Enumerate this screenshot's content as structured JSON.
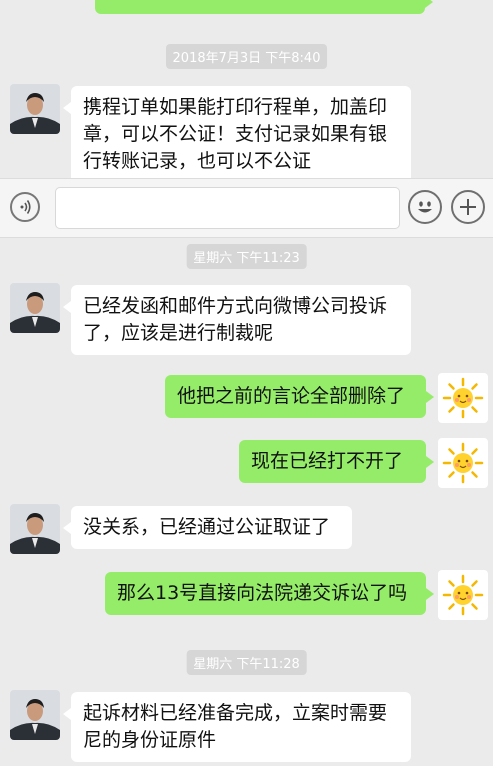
{
  "timestamps": [
    "2018年7月3日 下午8:40",
    "星期六 下午11:23",
    "星期六 下午11:28"
  ],
  "messages": [
    {
      "side": "in",
      "text": "携程订单如果能打印行程单，加盖印章，可以不公证！支付记录如果有银行转账记录，也可以不公证"
    },
    {
      "side": "in",
      "text": "已经发函和邮件方式向微博公司投诉了，应该是进行制裁呢"
    },
    {
      "side": "out",
      "text": "他把之前的言论全部删除了"
    },
    {
      "side": "out",
      "text": "现在已经打不开了"
    },
    {
      "side": "in",
      "text": "没关系，已经通过公证取证了"
    },
    {
      "side": "out",
      "text": "那么13号直接向法院递交诉讼了吗"
    },
    {
      "side": "in",
      "text": "起诉材料已经准备完成，立案时需要尼的身份证原件"
    }
  ],
  "input_bar": {
    "text_value": "",
    "voice_icon": "voice-wave-icon",
    "emoji_icon": "smiley-icon",
    "more_icon": "plus-icon"
  },
  "colors": {
    "chat_bg": "#ebebeb",
    "incoming_bubble": "#ffffff",
    "outgoing_bubble": "#95ec69",
    "timestamp_pill": "#d6d6d6"
  }
}
